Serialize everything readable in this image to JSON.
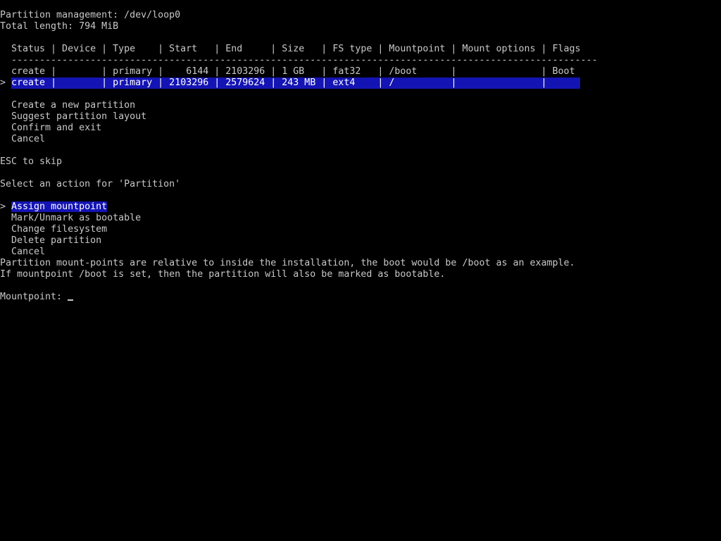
{
  "header": {
    "title": "Partition management: /dev/loop0",
    "total_length": "Total length: 794 MiB"
  },
  "table": {
    "header_row": "  Status | Device | Type    | Start   | End     | Size   | FS type | Mountpoint | Mount options | Flags",
    "separator": "  --------------------------------------------------------------------------------------------------------",
    "rows": [
      {
        "cursor": " ",
        "text": "create |        | primary |    6144 | 2103296 | 1 GB   | fat32   | /boot      |               | Boot"
      },
      {
        "cursor": ">",
        "text": "create |        | primary | 2103296 | 2579624 | 243 MB | ext4    | /          |               |"
      }
    ]
  },
  "partition_menu": {
    "items": [
      "Create a new partition",
      "Suggest partition layout",
      "Confirm and exit",
      "Cancel"
    ]
  },
  "esc_hint": "ESC to skip",
  "action_prompt": "Select an action for 'Partition'",
  "action_menu": {
    "cursor": ">",
    "items": [
      "Assign mountpoint",
      "Mark/Unmark as bootable",
      "Change filesystem",
      "Delete partition",
      "Cancel"
    ]
  },
  "help": {
    "line1": "Partition mount-points are relative to inside the installation, the boot would be /boot as an example.",
    "line2": "If mountpoint /boot is set, then the partition will also be marked as bootable."
  },
  "input": {
    "label": "Mountpoint: ",
    "value": ""
  },
  "colors": {
    "background": "#000000",
    "text": "#c8c8c8",
    "highlight": "#1414b4"
  }
}
